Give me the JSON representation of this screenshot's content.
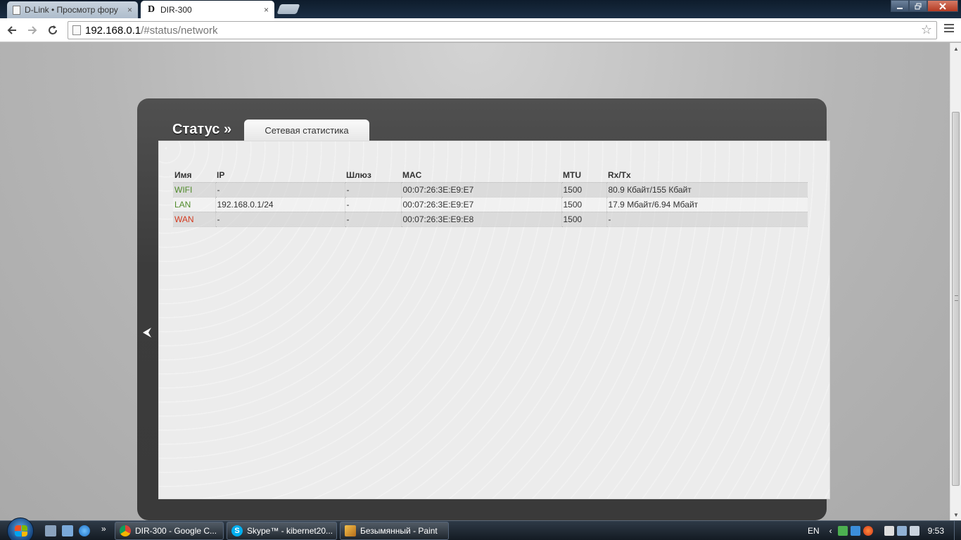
{
  "browser": {
    "tabs": [
      {
        "title": "D-Link • Просмотр фору",
        "active": false
      },
      {
        "title": "DIR-300",
        "active": true
      }
    ],
    "favicon_dlink": "D",
    "close_glyph": "×",
    "address": {
      "host": "192.168.0.1",
      "path": "/#status/network"
    },
    "icons": {
      "back": "back-arrow-icon",
      "forward": "forward-arrow-icon",
      "reload": "reload-icon",
      "bookmark": "star-icon",
      "menu": "menu-icon"
    }
  },
  "page": {
    "section_title": "Статус »",
    "active_tab": "Сетевая статистика",
    "table": {
      "columns": [
        "Имя",
        "IP",
        "Шлюз",
        "MAC",
        "MTU",
        "Rx/Tx"
      ],
      "rows": [
        {
          "name": "WIFI",
          "ip": "-",
          "gateway": "-",
          "mac": "00:07:26:3E:E9:E7",
          "mtu": "1500",
          "rxtx": "80.9 Кбайт/155 Кбайт",
          "status_color": "#4f8a2a"
        },
        {
          "name": "LAN",
          "ip": "192.168.0.1/24",
          "gateway": "-",
          "mac": "00:07:26:3E:E9:E7",
          "mtu": "1500",
          "rxtx": "17.9 Мбайт/6.94 Мбайт",
          "status_color": "#4f8a2a"
        },
        {
          "name": "WAN",
          "ip": "-",
          "gateway": "-",
          "mac": "00:07:26:3E:E9:E8",
          "mtu": "1500",
          "rxtx": "-",
          "status_color": "#d43a1f"
        }
      ]
    }
  },
  "taskbar": {
    "buttons": [
      {
        "label": "DIR-300 - Google C...",
        "icon": "chrome-icon"
      },
      {
        "label": "Skype™ - kibernet20...",
        "icon": "skype-icon"
      },
      {
        "label": "Безымянный - Paint",
        "icon": "paint-icon"
      }
    ],
    "overflow_glyph": "»",
    "language": "EN",
    "clock": "9:53"
  },
  "colors": {
    "accent_green": "#4f8a2a",
    "accent_red": "#d43a1f",
    "frame_dark": "#3c3c3c"
  }
}
